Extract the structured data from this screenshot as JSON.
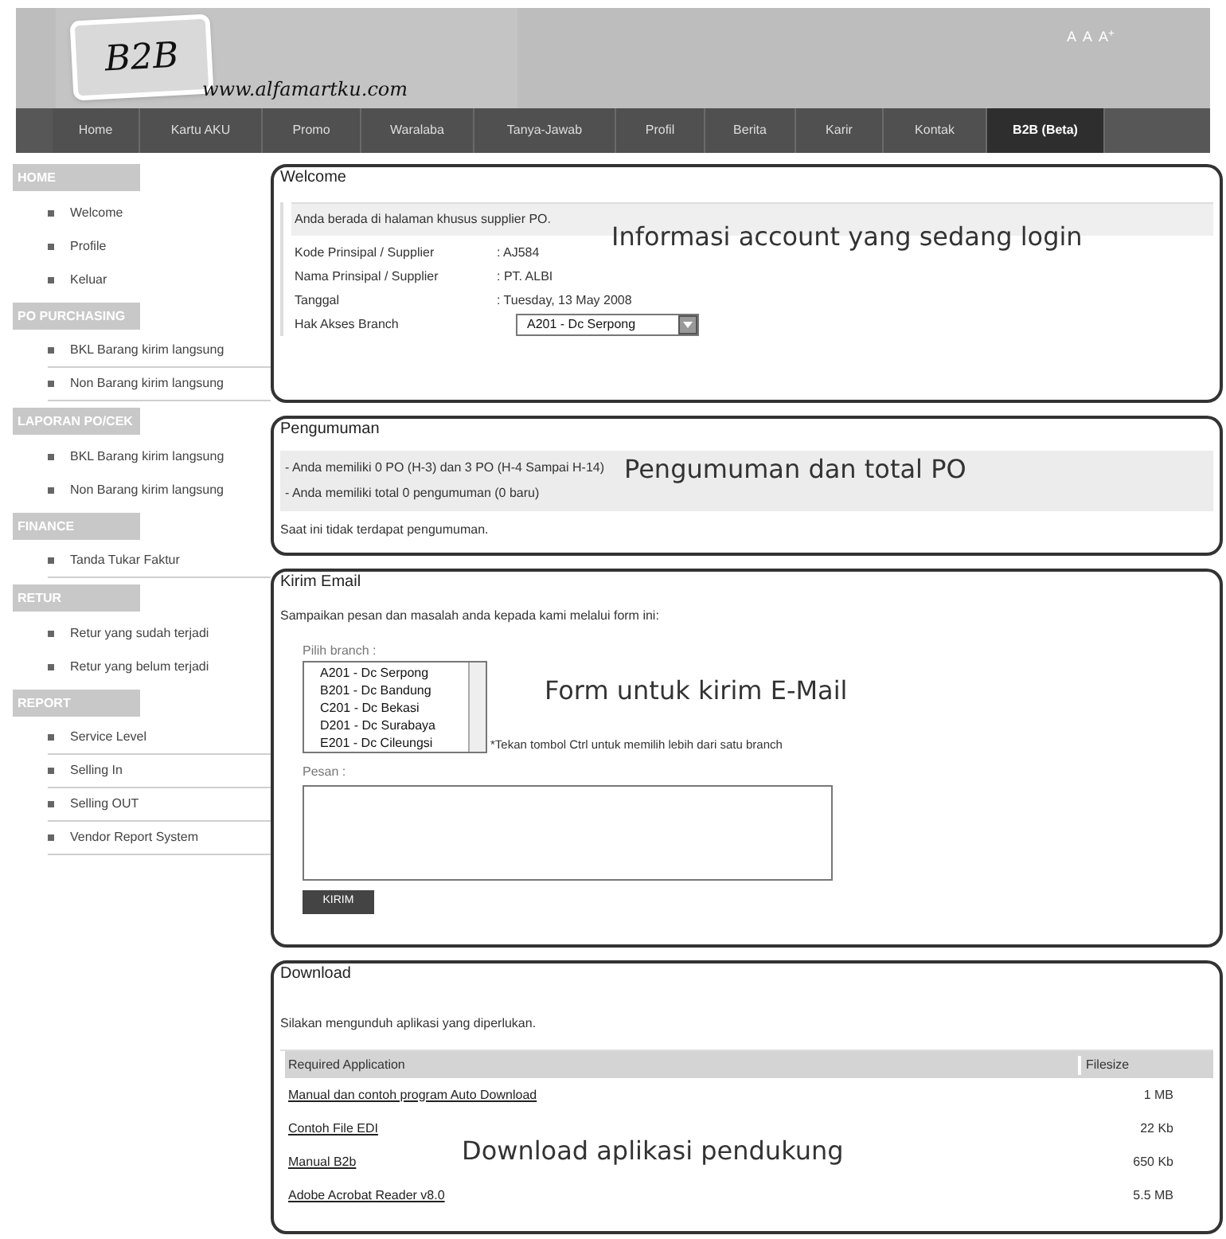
{
  "header": {
    "logo_title": "B2B",
    "logo_url": "www.alfamartku.com",
    "font_sizes": [
      "A",
      "A",
      "A$^{+}$"
    ]
  },
  "nav": [
    {
      "label": "Home",
      "selected": false
    },
    {
      "label": "Kartu AKU",
      "selected": false
    },
    {
      "label": "Promo",
      "selected": false
    },
    {
      "label": "Waralaba",
      "selected": false
    },
    {
      "label": "Tanya-Jawab",
      "selected": false
    },
    {
      "label": "Profil",
      "selected": false
    },
    {
      "label": "Berita",
      "selected": false
    },
    {
      "label": "Karir",
      "selected": false
    },
    {
      "label": "Kontak",
      "selected": false
    },
    {
      "label": "B2B (Beta)",
      "selected": true
    }
  ],
  "sidebar": [
    {
      "title": "HOME",
      "items": [
        {
          "label": "Welcome",
          "underlined": false
        },
        {
          "label": "Profile",
          "underlined": false
        },
        {
          "label": "Keluar",
          "underlined": false
        }
      ]
    },
    {
      "title": "PO PURCHASING",
      "items": [
        {
          "label": "BKL Barang kirim langsung",
          "underlined": true
        },
        {
          "label": "Non Barang kirim langsung",
          "underlined": true
        }
      ]
    },
    {
      "title": "LAPORAN PO/CEK",
      "items": [
        {
          "label": "BKL Barang kirim langsung",
          "underlined": false
        },
        {
          "label": "Non Barang kirim langsung",
          "underlined": false
        }
      ]
    },
    {
      "title": "FINANCE",
      "items": [
        {
          "label": "Tanda Tukar Faktur",
          "underlined": true
        }
      ]
    },
    {
      "title": "RETUR",
      "items": [
        {
          "label": "Retur yang sudah terjadi",
          "underlined": false
        },
        {
          "label": "Retur yang belum terjadi",
          "underlined": false
        }
      ]
    },
    {
      "title": "REPORT",
      "items": [
        {
          "label": "Service Level",
          "underlined": true
        },
        {
          "label": "Selling In",
          "underlined": true
        },
        {
          "label": "Selling OUT",
          "underlined": true
        },
        {
          "label": "Vendor Report System",
          "underlined": true
        }
      ]
    }
  ],
  "welcome": {
    "title": "Welcome",
    "intro": "Anda berada di halaman khusus supplier PO.",
    "annotation": "Informasi account yang sedang login",
    "fields": [
      {
        "kind": "text",
        "label": "Kode Prinsipal / Supplier",
        "value": ": AJ584"
      },
      {
        "kind": "text",
        "label": "Nama Prinsipal / Supplier",
        "value": ": PT. ALBI"
      },
      {
        "kind": "text",
        "label": "Tanggal",
        "value": ": Tuesday, 13 May 2008"
      },
      {
        "kind": "select",
        "label": "Hak Akses Branch",
        "value": "A201 - Dc Serpong"
      }
    ]
  },
  "announcements": {
    "title": "Pengumuman",
    "annotation": "Pengumuman dan total PO",
    "lines": [
      "- Anda memiliki 0 PO (H-3) dan 3 PO (H-4 Sampai H-14)",
      "- Anda memiliki total 0 pengumuman (0 baru)"
    ],
    "note": "Saat ini tidak terdapat pengumuman."
  },
  "email": {
    "title": "Kirim Email",
    "annotation": "Form untuk kirim E-Mail",
    "intro": "Sampaikan pesan dan masalah anda kepada kami melalui form ini:",
    "branch_label": "Pilih branch :",
    "branches": [
      "A201 - Dc Serpong",
      "B201 - Dc Bandung",
      "C201 - Dc Bekasi",
      "D201 - Dc Surabaya",
      "E201 - Dc Cileungsi"
    ],
    "hint": "*Tekan tombol Ctrl untuk memilih lebih dari satu branch",
    "message_label": "Pesan :",
    "submit": "KIRIM"
  },
  "download": {
    "title": "Download",
    "annotation": "Download aplikasi pendukung",
    "intro": "Silakan mengunduh aplikasi yang diperlukan.",
    "columns": [
      "Required Application",
      "Filesize"
    ],
    "rows": [
      {
        "name": "Manual dan contoh program Auto Download",
        "size": "1 MB"
      },
      {
        "name": "Contoh File EDI",
        "size": "22 Kb"
      },
      {
        "name": "Manual B2b",
        "size": "650 Kb"
      },
      {
        "name": "Adobe Acrobat Reader v8.0",
        "size": "5.5 MB"
      }
    ]
  }
}
